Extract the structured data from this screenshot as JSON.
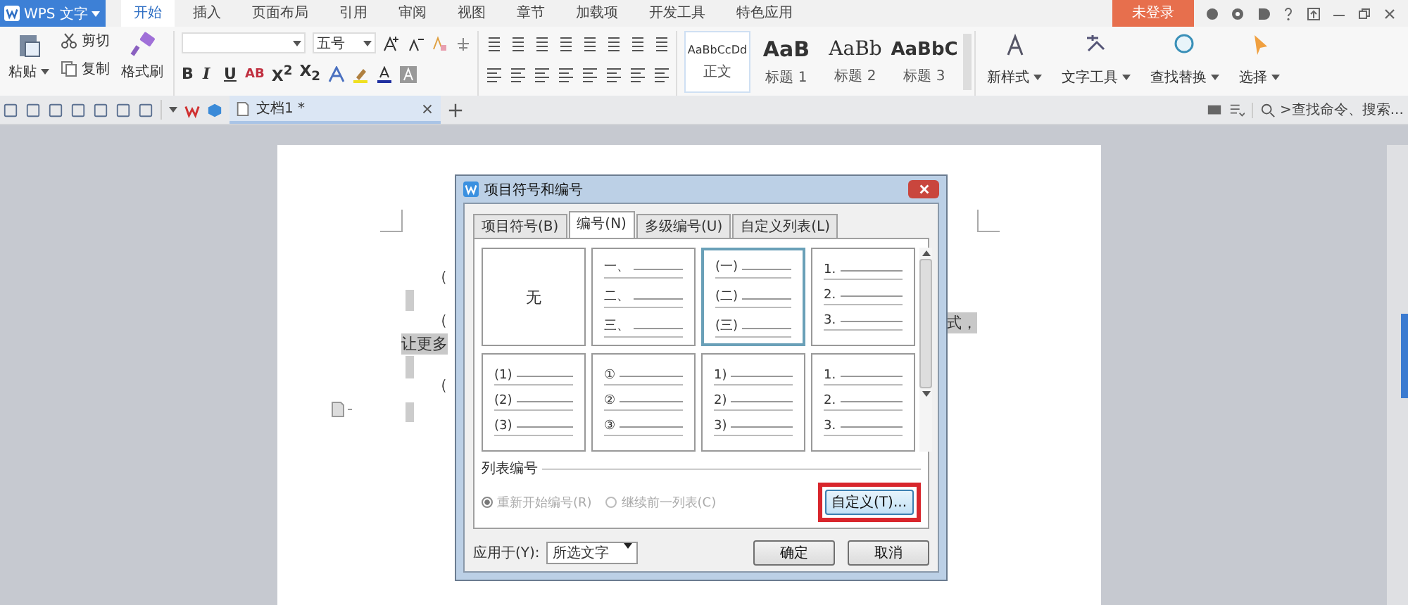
{
  "app": {
    "name": "WPS 文字"
  },
  "menu_tabs": [
    {
      "label": "开始",
      "selected": true
    },
    {
      "label": "插入",
      "selected": false
    },
    {
      "label": "页面布局",
      "selected": false
    },
    {
      "label": "引用",
      "selected": false
    },
    {
      "label": "审阅",
      "selected": false
    },
    {
      "label": "视图",
      "selected": false
    },
    {
      "label": "章节",
      "selected": false
    },
    {
      "label": "加载项",
      "selected": false
    },
    {
      "label": "开发工具",
      "selected": false
    },
    {
      "label": "特色应用",
      "selected": false
    }
  ],
  "login_button": "未登录",
  "ribbon": {
    "clipboard": {
      "paste": "粘贴",
      "cut": "剪切",
      "copy": "复制",
      "format_painter": "格式刷"
    },
    "font": {
      "size": "五号",
      "format_buttons": [
        "B",
        "I",
        "U",
        "AB",
        "X$^{2}$",
        "X$_{2}$"
      ]
    },
    "styles": [
      {
        "preview": "AaBbCcDd",
        "label": "正文",
        "selected": true
      },
      {
        "preview": "AaB",
        "label": "标题 1",
        "selected": false
      },
      {
        "preview": "AaBb",
        "label": "标题 2",
        "selected": false
      },
      {
        "preview": "AaBbC",
        "label": "标题 3",
        "selected": false
      }
    ],
    "tools": [
      "新样式",
      "文字工具",
      "查找替换",
      "选择"
    ]
  },
  "document_tab": {
    "title": "文档1 *"
  },
  "command_search": {
    "placeholder": ">查找命令、搜索..."
  },
  "document": {
    "fragments": [
      {
        "text": "（",
        "highlighted": false
      },
      {
        "text": "（",
        "highlighted": false
      },
      {
        "text": "式，",
        "highlighted": true
      },
      {
        "text": "让更多",
        "highlighted": true
      },
      {
        "text": "（",
        "highlighted": false
      }
    ]
  },
  "dialog": {
    "title": "项目符号和编号",
    "tabs": [
      {
        "label": "项目符号(B)",
        "selected": false
      },
      {
        "label": "编号(N)",
        "selected": true
      },
      {
        "label": "多级编号(U)",
        "selected": false
      },
      {
        "label": "自定义列表(L)",
        "selected": false
      }
    ],
    "styles": [
      {
        "kind": "none",
        "label": "无",
        "selected": false
      },
      {
        "kind": "list",
        "markers": [
          "一、",
          "二、",
          "三、"
        ],
        "selected": false
      },
      {
        "kind": "list",
        "markers": [
          "(一)",
          "(二)",
          "(三)"
        ],
        "selected": true
      },
      {
        "kind": "list",
        "markers": [
          "1.",
          "2.",
          "3."
        ],
        "selected": false
      },
      {
        "kind": "list",
        "markers": [
          "(1)",
          "(2)",
          "(3)"
        ],
        "selected": false
      },
      {
        "kind": "list",
        "markers": [
          "①",
          "②",
          "③"
        ],
        "selected": false
      },
      {
        "kind": "list",
        "markers": [
          "1)",
          "2)",
          "3)"
        ],
        "selected": false
      },
      {
        "kind": "list",
        "markers": [
          "1.",
          "2.",
          "3."
        ],
        "selected": false
      }
    ],
    "list_numbering": {
      "title": "列表编号",
      "options": [
        {
          "label": "重新开始编号(R)",
          "selected": true,
          "disabled": true
        },
        {
          "label": "继续前一列表(C)",
          "selected": false,
          "disabled": true
        }
      ]
    },
    "customize_button": {
      "label": "自定义(T)...",
      "highlighted": true
    },
    "apply_to": {
      "label": "应用于(Y):",
      "value": "所选文字"
    },
    "buttons": [
      "确定",
      "取消"
    ]
  }
}
